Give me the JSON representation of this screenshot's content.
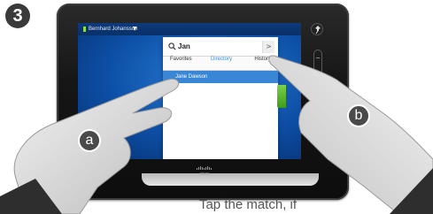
{
  "step": {
    "number": "3"
  },
  "device": {
    "brand": "cisco",
    "topbar": {
      "user": "Bernhard Johansson",
      "caret": "▼"
    }
  },
  "search": {
    "query": "Jan",
    "go_symbol": ">"
  },
  "tabs": [
    {
      "label": "Favorites"
    },
    {
      "label": "Directory",
      "active": true
    },
    {
      "label": "History"
    }
  ],
  "results": [
    {
      "name": "Jane Dawson",
      "selected": true
    }
  ],
  "hands": {
    "left_label": "a",
    "right_label": "b"
  },
  "caption": "Tap the match, if",
  "colors": {
    "screen_blue": "#0d4fa6",
    "selection_blue": "#3a86d6",
    "active_tab": "#3f8fe3",
    "status_green": "#8ee04a"
  },
  "icons": [
    "search-icon",
    "pin-icon",
    "slider-icon"
  ]
}
